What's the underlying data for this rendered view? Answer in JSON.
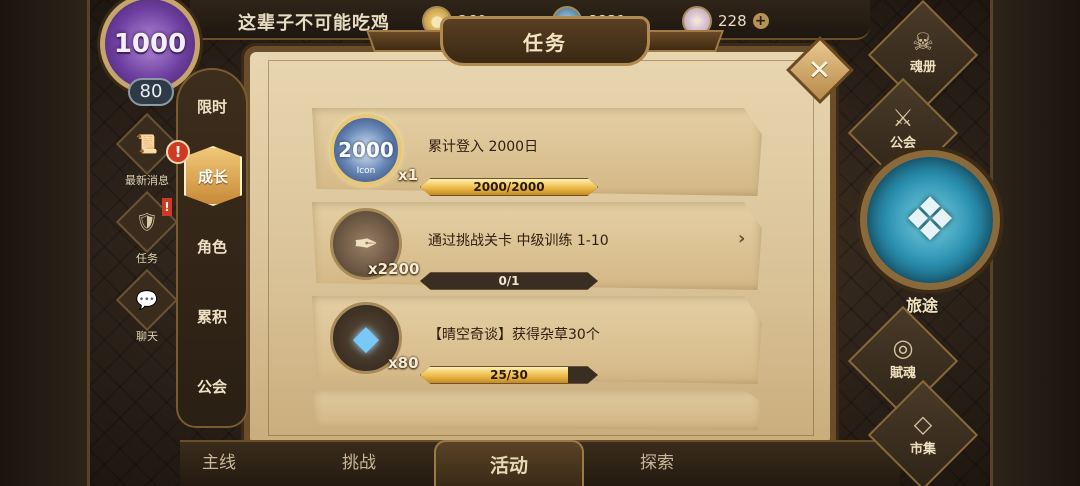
{
  "header": {
    "player_name": "这辈子不可能吃鸡",
    "level_badge_text": "1000",
    "level": "80",
    "currencies": [
      {
        "icon": "gold-coin-icon",
        "amount": "260"
      },
      {
        "icon": "gem-icon",
        "amount": "8831"
      },
      {
        "icon": "crystal-shard-icon",
        "amount": "228"
      }
    ],
    "plus_label": "+"
  },
  "left_shortcuts": [
    {
      "id": "news",
      "label": "最新消息",
      "icon": "scroll-icon",
      "glyph": "📜"
    },
    {
      "id": "tasks",
      "label": "任务",
      "icon": "shield-icon",
      "glyph": "🛡"
    },
    {
      "id": "chat",
      "label": "聊天",
      "icon": "chat-bubble-icon",
      "glyph": "💬"
    }
  ],
  "alerts": {
    "news": "!",
    "tasks": "!",
    "tab_growth": "!"
  },
  "dialog": {
    "title": "任务",
    "close_glyph": "✕"
  },
  "tabs": [
    {
      "label": "限时",
      "active": false
    },
    {
      "label": "成长",
      "active": true
    },
    {
      "label": "角色",
      "active": false
    },
    {
      "label": "累积",
      "active": false
    },
    {
      "label": "公会",
      "active": false
    }
  ],
  "tasks": [
    {
      "title": "累计登入 2000日",
      "reward_icon": "achievement-badge-icon",
      "reward_badge_text": "2000",
      "reward_badge_caption": "Icon",
      "reward_qty": "x1",
      "progress_text": "2000/2000",
      "progress": 1.0,
      "has_arrow": false
    },
    {
      "title": "通过挑战关卡 中级训练 1-10",
      "reward_icon": "scroll-quill-icon",
      "reward_qty": "x2200",
      "progress_text": "0/1",
      "progress": 0.0,
      "has_arrow": true
    },
    {
      "title": "【晴空奇谈】获得杂草30个",
      "reward_icon": "blue-crystal-icon",
      "reward_qty": "x80",
      "progress_text": "25/30",
      "progress": 0.8333,
      "has_arrow": false
    }
  ],
  "bottom_nav": [
    {
      "label": "主线"
    },
    {
      "label": "挑战"
    },
    {
      "label": "活动"
    },
    {
      "label": "探索"
    }
  ],
  "right_nav": [
    {
      "label": "魂册",
      "icon": "demon-mask-icon",
      "glyph": "☠"
    },
    {
      "label": "公会",
      "icon": "guild-banner-icon",
      "glyph": "⚔"
    },
    {
      "label": "旅途",
      "icon": "journey-emblem-icon",
      "glyph": "❖"
    },
    {
      "label": "賦魂",
      "icon": "soul-swirl-icon",
      "glyph": "◎"
    },
    {
      "label": "市集",
      "icon": "market-gem-icon",
      "glyph": "◇"
    }
  ],
  "colors": {
    "accent_gold": "#f0c050",
    "alert_red": "#d03a22",
    "parchment": "#e8d6b0"
  }
}
